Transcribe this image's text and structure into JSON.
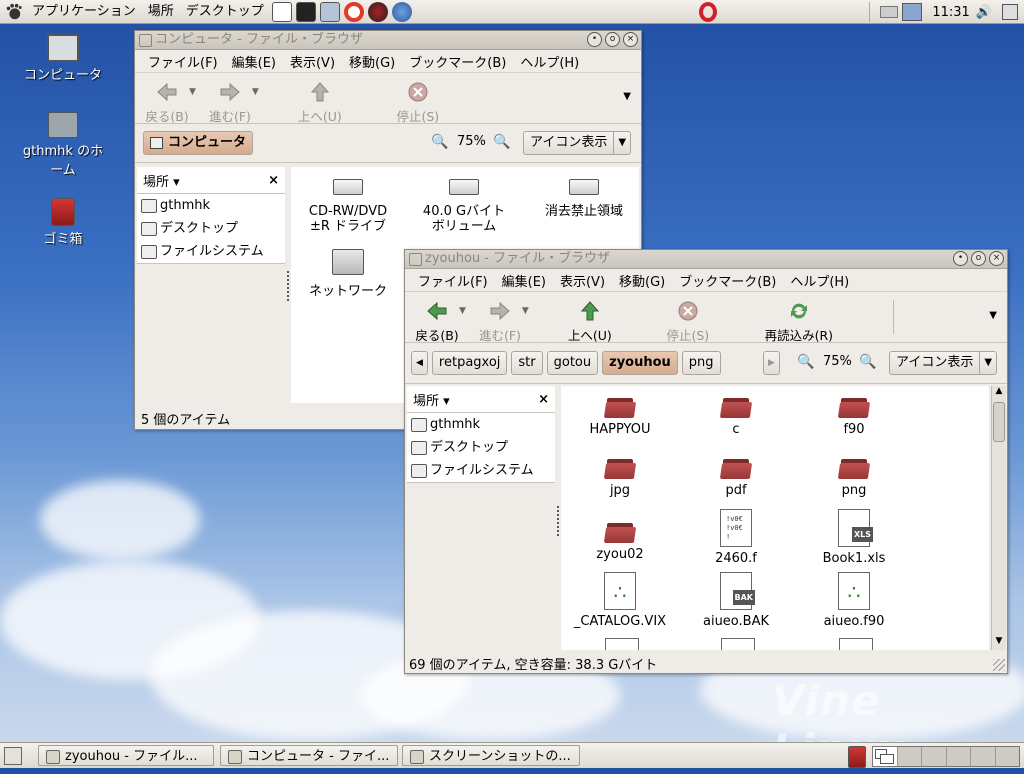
{
  "top_panel": {
    "menus": [
      "アプリケーション",
      "場所",
      "デスクトップ"
    ],
    "clock": "11:31"
  },
  "desktop": {
    "icons": [
      {
        "label": "コンピュータ",
        "icon": "computer-icon"
      },
      {
        "label": "gthmhk のホーム",
        "icon": "home-folder-icon"
      },
      {
        "label": "ゴミ箱",
        "icon": "trash-icon"
      }
    ],
    "watermark": "Vine Linux"
  },
  "win1": {
    "title": "コンピュータ - ファイル・ブラウザ",
    "menu": [
      "ファイル(F)",
      "編集(E)",
      "表示(V)",
      "移動(G)",
      "ブックマーク(B)",
      "ヘルプ(H)"
    ],
    "toolbar": {
      "back": "戻る(B)",
      "forward": "進む(F)",
      "up": "上へ(U)",
      "stop": "停止(S)"
    },
    "location_button": "コンピュータ",
    "zoom": "75%",
    "view_mode": "アイコン表示",
    "sidebar": {
      "header": "場所",
      "items": [
        "gthmhk",
        "デスクトップ",
        "ファイルシステム"
      ]
    },
    "items": [
      {
        "line1": "CD-RW/DVD",
        "line2": "±R ドライブ"
      },
      {
        "line1": "40.0 Gバイト",
        "line2": "ボリューム"
      },
      {
        "line1": "消去禁止領域",
        "line2": ""
      },
      {
        "line1": "ネットワーク",
        "line2": ""
      }
    ],
    "status": "5 個のアイテム"
  },
  "win2": {
    "title": "zyouhou - ファイル・ブラウザ",
    "menu": [
      "ファイル(F)",
      "編集(E)",
      "表示(V)",
      "移動(G)",
      "ブックマーク(B)",
      "ヘルプ(H)"
    ],
    "toolbar": {
      "back": "戻る(B)",
      "forward": "進む(F)",
      "up": "上へ(U)",
      "stop": "停止(S)",
      "reload": "再読込み(R)"
    },
    "path": [
      "retpagxoj",
      "str",
      "gotou",
      "zyouhou",
      "png"
    ],
    "current_path_index": 3,
    "zoom": "75%",
    "view_mode": "アイコン表示",
    "sidebar": {
      "header": "場所",
      "items": [
        "gthmhk",
        "デスクトップ",
        "ファイルシステム"
      ]
    },
    "files": [
      {
        "name": "HAPPYOU",
        "type": "folder"
      },
      {
        "name": "c",
        "type": "folder"
      },
      {
        "name": "f90",
        "type": "folder"
      },
      {
        "name": "jpg",
        "type": "folder"
      },
      {
        "name": "pdf",
        "type": "folder"
      },
      {
        "name": "png",
        "type": "folder"
      },
      {
        "name": "zyou02",
        "type": "folder"
      },
      {
        "name": "2460.f",
        "type": "text"
      },
      {
        "name": "Book1.xls",
        "type": "xls"
      },
      {
        "name": "_CATALOG.VIX",
        "type": "gnome"
      },
      {
        "name": "aiueo.BAK",
        "type": "bak"
      },
      {
        "name": "aiueo.f90",
        "type": "gnome"
      }
    ],
    "status": "69 個のアイテム, 空き容量: 38.3 Gバイト"
  },
  "taskbar": {
    "tasks": [
      "zyouhou - ファイル...",
      "コンピュータ - ファイ...",
      "スクリーンショットの..."
    ]
  },
  "colors": {
    "folder": "#b04545",
    "accent": "#d6ab8e"
  }
}
